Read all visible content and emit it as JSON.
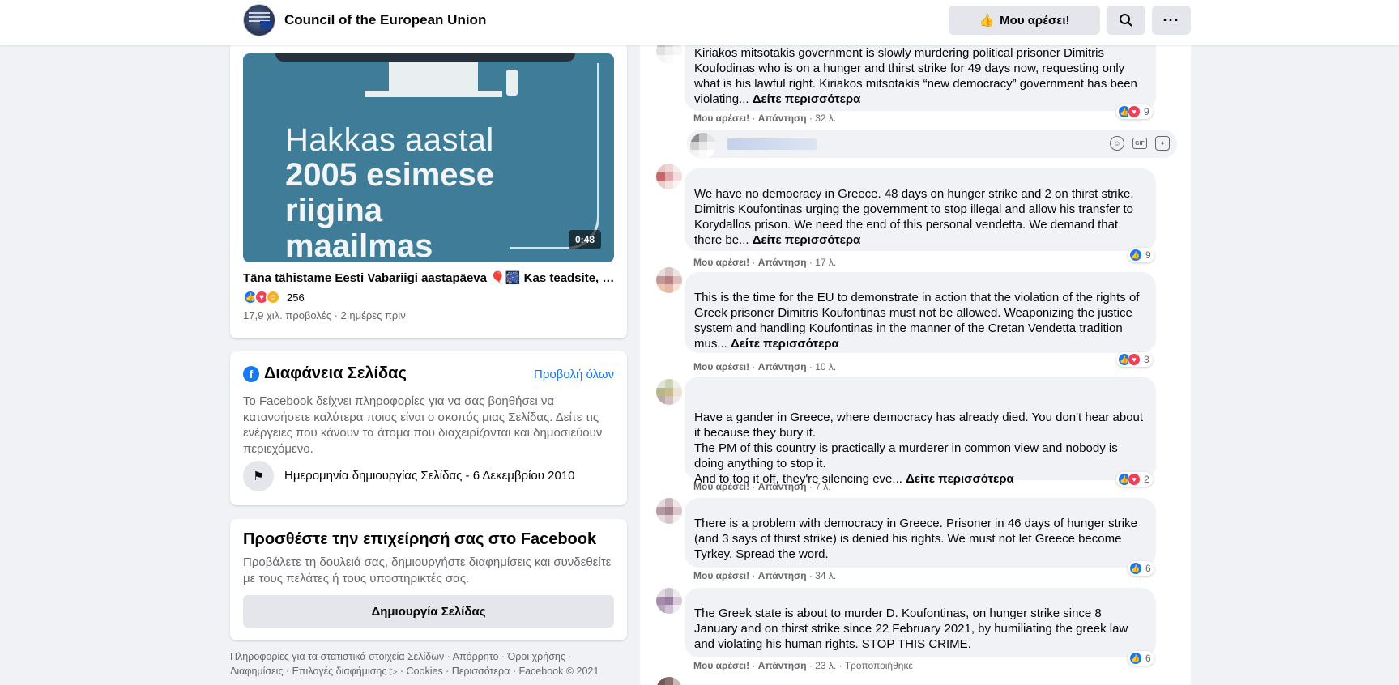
{
  "header": {
    "page_name": "Council of the European Union",
    "like_label": "Μου αρέσει!",
    "search_icon": "search-icon",
    "more_icon": "more-icon"
  },
  "video_card": {
    "video_text": [
      "Hakkas aastal",
      "2005 esimese",
      "riigina",
      "maailmas"
    ],
    "duration": "0:48",
    "title": "Täna tähistame Eesti Vabariigi aastapäeva 🎈🎆 Kas teadsite, et...",
    "reaction_count": "256",
    "meta": "17,9 χιλ. προβολές · 2 ημέρες πριν"
  },
  "transparency": {
    "title": "Διαφάνεια Σελίδας",
    "see_all": "Προβολή όλων",
    "description": "Το Facebook δείχνει πληροφορίες για να σας βοηθήσει να κατανοήσετε καλύτερα ποιος είναι ο σκοπός μιας Σελίδας. Δείτε τις ενέργειες που κάνουν τα άτομα που διαχειρίζονται και δημοσιεύουν περιεχόμενο.",
    "created": "Ημερομηνία δημιουργίας Σελίδας - 6 Δεκεμβρίου 2010"
  },
  "business": {
    "title": "Προσθέστε την επιχείρησή σας στο Facebook",
    "description": "Προβάλετε τη δουλειά σας, δημιουργήστε διαφημίσεις και συνδεθείτε με τους πελάτες ή τους υποστηρικτές σας.",
    "button": "Δημιουργία Σελίδας"
  },
  "footer": {
    "line1": "Πληροφορίες για τα στατιστικά στοιχεία Σελίδων · Απόρρητο · Όροι χρήσης ·",
    "line2": "Διαφημίσεις · Επιλογές διαφήμισης ▷ · Cookies · Περισσότερα · Facebook © 2021"
  },
  "comments": [
    {
      "text": "Kiriakos mitsotakis government is slowly murdering political prisoner Dimitris Koufodinas who is on a hunger and thirst strike for 49 days now, requesting only what is his lawful right. Kiriakos mitsotakis “new democracy” government has been violating... ",
      "more": "Δείτε περισσότερα",
      "like": "Μου αρέσει!",
      "reply": "Απάντηση",
      "time": "32 λ.",
      "reactions": "9"
    },
    {
      "text": "We have no democracy in Greece. 48 days on hunger strike and 2 on thirst strike, Dimitris Koufontinas urging the government to stop illegal and allow his transfer to Korydallos prison. We need the end of this personal vendetta. We demand that there be... ",
      "more": "Δείτε περισσότερα",
      "like": "Μου αρέσει!",
      "reply": "Απάντηση",
      "time": "17 λ.",
      "reactions": "9"
    },
    {
      "text": "This is the time for the EU to demonstrate in action that the violation of the rights of Greek prisoner Dimitris Koufontinas must not be allowed. Weaponizing the justice system and handling Koufontinas in the manner of the Cretan Vendetta tradition mus... ",
      "more": "Δείτε περισσότερα",
      "like": "Μου αρέσει!",
      "reply": "Απάντηση",
      "time": "10 λ.",
      "reactions": "3"
    },
    {
      "text": "Have a gander in Greece, where democracy has already died. You don't hear about it because they bury it.\nThe PM of this country is practically a murderer in common view and nobody is doing anything to stop it.\nAnd to top it off, they're silencing eve... ",
      "more": "Δείτε περισσότερα",
      "like": "Μου αρέσει!",
      "reply": "Απάντηση",
      "time": "7 λ.",
      "reactions": "2"
    },
    {
      "text": "There is a problem with democracy in Greece. Prisoner in 46 days of hunger strike (and 3 says of thirst strike) is denied his rights. We must not let Greece become Tyrkey. Spread the word.",
      "more": "",
      "like": "Μου αρέσει!",
      "reply": "Απάντηση",
      "time": "34 λ.",
      "reactions": "6"
    },
    {
      "text": "The Greek state is about to murder D. Koufontinas, on hunger strike since 8 January and on thirst strike since 22 February 2021, by humiliating the greek law and violating his human rights. STOP THIS CRIME.",
      "more": "",
      "like": "Μου αρέσει!",
      "reply": "Απάντηση",
      "time": "23 λ.",
      "edited": "Τροποποιήθηκε",
      "reactions": "6"
    }
  ],
  "colors": {
    "accent": "#1877f2",
    "love": "#f33e58",
    "haha": "#f7b125",
    "secondary_text": "#65676b",
    "video_bg": "#3f7c98"
  }
}
